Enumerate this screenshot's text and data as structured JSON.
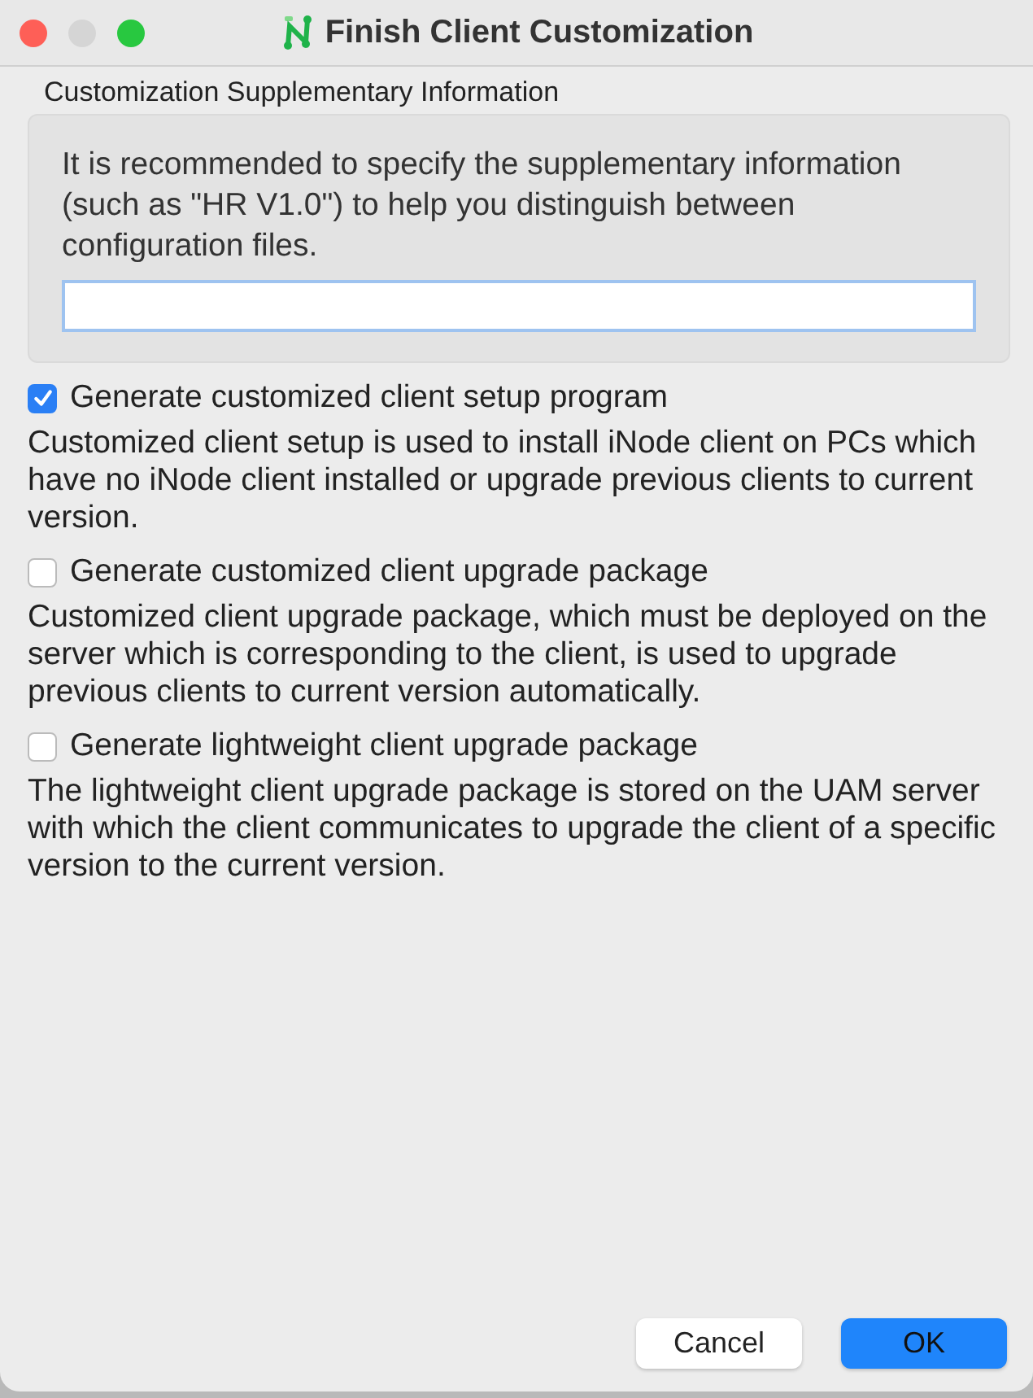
{
  "window": {
    "title": "Finish Client Customization"
  },
  "supplementary": {
    "label": "Customization Supplementary Information",
    "hint": "It is recommended to specify the supplementary information (such as \"HR V1.0\") to help you distinguish between configuration files.",
    "field_focused": true
  },
  "options": [
    {
      "label": "Generate customized client setup program",
      "checked": true,
      "description": "Customized client setup is used to install iNode client on PCs which have no iNode client installed or upgrade previous clients to current version."
    },
    {
      "label": "Generate customized client upgrade package",
      "checked": false,
      "description": "Customized client upgrade package, which must be deployed on the server which is corresponding to the client, is used to upgrade previous clients to current version automatically."
    },
    {
      "label": "Generate lightweight client upgrade package",
      "checked": false,
      "description": "The lightweight client upgrade package is stored on the UAM server with which the client communicates to upgrade the client of a specific version to the current version."
    }
  ],
  "buttons": [
    {
      "label": "Cancel",
      "kind": "secondary"
    },
    {
      "label": "OK",
      "kind": "primary"
    }
  ]
}
